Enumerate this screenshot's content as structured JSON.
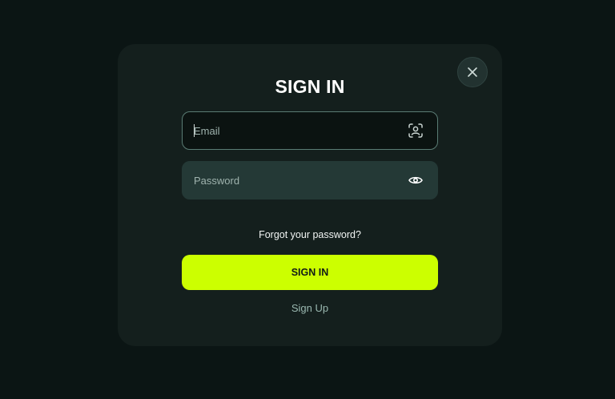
{
  "modal": {
    "title": "SIGN IN",
    "close_icon": "close-icon"
  },
  "email": {
    "placeholder": "Email",
    "value": "",
    "icon": "face-scan-icon"
  },
  "password": {
    "placeholder": "Password",
    "value": "",
    "icon": "eye-icon"
  },
  "links": {
    "forgot": "Forgot your password?",
    "signup": "Sign Up"
  },
  "submit": {
    "label": "SIGN IN"
  },
  "colors": {
    "accent": "#ccff00",
    "background": "#0b1514",
    "modal": "#141f1d"
  }
}
